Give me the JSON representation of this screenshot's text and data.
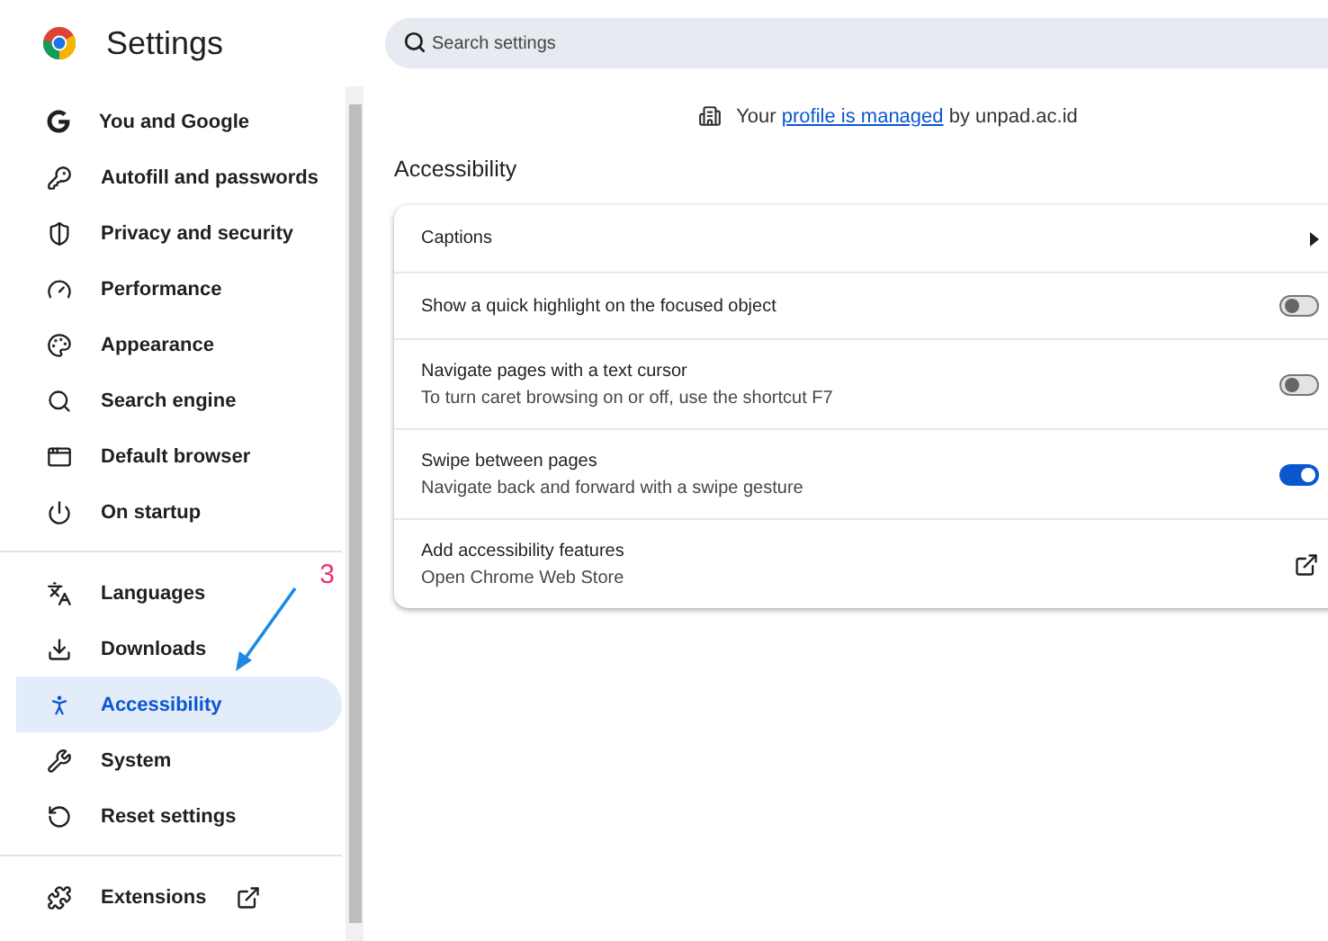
{
  "header": {
    "title": "Settings"
  },
  "search": {
    "placeholder": "Search settings"
  },
  "sidebar": {
    "groups": [
      {
        "items": [
          {
            "label": "You and Google",
            "selected": false
          },
          {
            "label": "Autofill and passwords",
            "selected": false
          },
          {
            "label": "Privacy and security",
            "selected": false
          },
          {
            "label": "Performance",
            "selected": false
          },
          {
            "label": "Appearance",
            "selected": false
          },
          {
            "label": "Search engine",
            "selected": false
          },
          {
            "label": "Default browser",
            "selected": false
          },
          {
            "label": "On startup",
            "selected": false
          }
        ]
      },
      {
        "items": [
          {
            "label": "Languages",
            "selected": false
          },
          {
            "label": "Downloads",
            "selected": false
          },
          {
            "label": "Accessibility",
            "selected": true
          },
          {
            "label": "System",
            "selected": false
          },
          {
            "label": "Reset settings",
            "selected": false
          }
        ]
      },
      {
        "items": [
          {
            "label": "Extensions",
            "selected": false,
            "external": true
          }
        ]
      }
    ]
  },
  "annotation": {
    "label": "3"
  },
  "managed_notice": {
    "before": "Your",
    "link": "profile is managed",
    "after": "by unpad.ac.id"
  },
  "section_title": "Accessibility",
  "rows": [
    {
      "kind": "submenu",
      "title": "Captions"
    },
    {
      "kind": "toggle",
      "title": "Show a quick highlight on the focused object",
      "on": false
    },
    {
      "kind": "toggle",
      "title": "Navigate pages with a text cursor",
      "subtitle": "To turn caret browsing on or off, use the shortcut F7",
      "on": false
    },
    {
      "kind": "toggle",
      "title": "Swipe between pages",
      "subtitle": "Navigate back and forward with a swipe gesture",
      "on": true
    },
    {
      "kind": "external",
      "title": "Add accessibility features",
      "subtitle": "Open Chrome Web Store"
    }
  ]
}
